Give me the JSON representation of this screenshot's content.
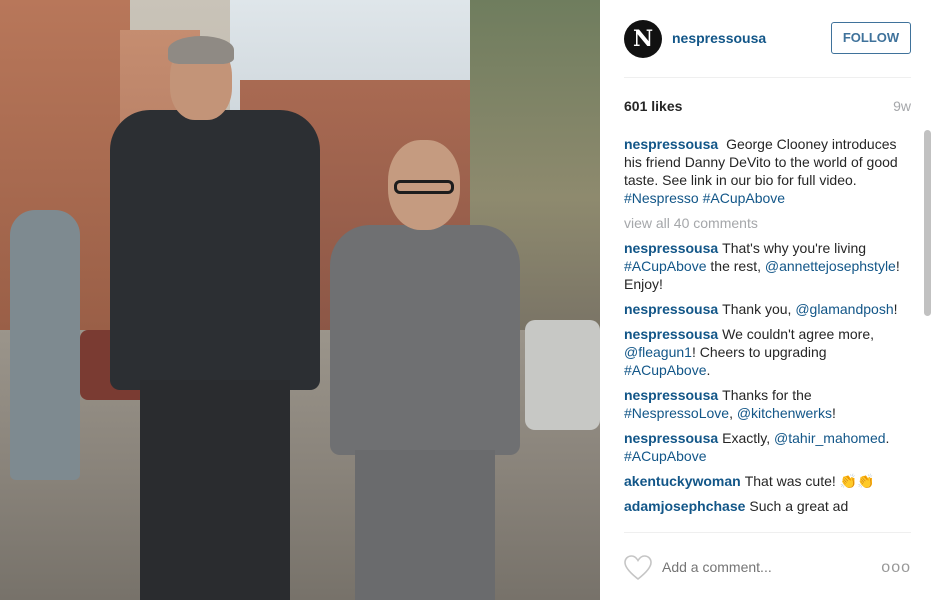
{
  "post": {
    "username": "nespressousa",
    "avatar_letter": "N",
    "follow_label": "FOLLOW",
    "likes": "601 likes",
    "age": "9w"
  },
  "caption": {
    "user": "nespressousa",
    "text": "George Clooney introduces his friend Danny DeVito to the world of good taste. See link in our bio for full video.",
    "tag1": "#Nespresso",
    "tag2": "#ACupAbove"
  },
  "view_all": "view all 40 comments",
  "comments": [
    {
      "user": "nespressousa",
      "t1": "That's why you're living ",
      "tag1": "#ACupAbove",
      "t2": " the rest, ",
      "tag2": "@annettejosephstyle",
      "t3": "! Enjoy!"
    },
    {
      "user": "nespressousa",
      "t1": "Thank you, ",
      "tag1": "@glamandposh",
      "t2": "!"
    },
    {
      "user": "nespressousa",
      "t1": "We couldn't agree more, ",
      "tag1": "@fleagun1",
      "t2": "! Cheers to upgrading ",
      "tag2": "#ACupAbove",
      "t3": "."
    },
    {
      "user": "nespressousa",
      "t1": "Thanks for the ",
      "tag1": "#NespressoLove",
      "t2": ", ",
      "tag2": "@kitchenwerks",
      "t3": "!"
    },
    {
      "user": "nespressousa",
      "t1": "Exactly, ",
      "tag1": "@tahir_mahomed",
      "t2": ". ",
      "tag2": "#ACupAbove"
    },
    {
      "user": "akentuckywoman",
      "t1": "That was cute! 👏👏"
    },
    {
      "user": "adamjosephchase",
      "t1": "Such a great ad"
    }
  ],
  "footer": {
    "add_comment_placeholder": "Add a comment...",
    "more_label": "ooo"
  },
  "icons": {
    "heart": "heart-icon",
    "more": "more-options-icon"
  },
  "colors": {
    "link": "#125688",
    "follow": "#3f729b",
    "muted": "#a5a7aa"
  }
}
